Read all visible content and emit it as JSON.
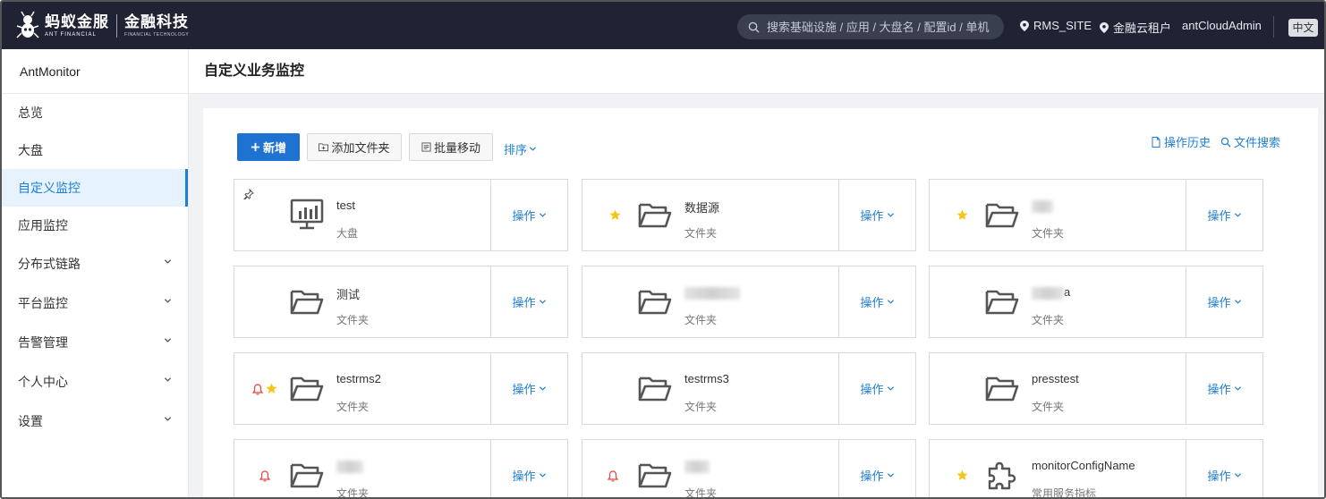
{
  "header": {
    "logo_brand": "蚂蚁金服",
    "logo_brand_en": "ANT FINANCIAL",
    "logo_sub": "金融科技",
    "logo_sub_en": "FINANCIAL TECHNOLOGY",
    "search_placeholder": "搜索基础设施 / 应用 / 大盘名 / 配置id / 单机",
    "site": "RMS_SITE",
    "tenant": "金融云租户",
    "user": "antCloudAdmin",
    "lang": "中文"
  },
  "sidebar": {
    "app_name": "AntMonitor",
    "items": [
      {
        "label": "总览"
      },
      {
        "label": "大盘"
      },
      {
        "label": "自定义监控"
      },
      {
        "label": "应用监控"
      },
      {
        "label": "分布式链路"
      },
      {
        "label": "平台监控"
      },
      {
        "label": "告警管理"
      },
      {
        "label": "个人中心"
      },
      {
        "label": "设置"
      }
    ]
  },
  "page": {
    "title": "自定义业务监控",
    "new_btn": "新增",
    "add_folder_btn": "添加文件夹",
    "batch_move_btn": "批量移动",
    "sort_label": "排序",
    "history_link": "操作历史",
    "file_search_link": "文件搜索",
    "op_label": "操作"
  },
  "cards": [
    {
      "name": "test",
      "type": "大盘",
      "icon": "dashboard-icon",
      "pinned": true
    },
    {
      "name": "数据源",
      "type": "文件夹",
      "icon": "folder-icon",
      "starred": true
    },
    {
      "name": "",
      "type": "文件夹",
      "icon": "folder-icon",
      "starred": true,
      "blurred": true
    },
    {
      "name": "测试",
      "type": "文件夹",
      "icon": "folder-icon"
    },
    {
      "name": "",
      "type": "文件夹",
      "icon": "folder-icon",
      "blurred": true
    },
    {
      "name": "a",
      "type": "文件夹",
      "icon": "folder-icon",
      "blurred": true
    },
    {
      "name": "testrms2",
      "type": "文件夹",
      "icon": "folder-icon",
      "alert": true,
      "starred": true
    },
    {
      "name": "testrms3",
      "type": "文件夹",
      "icon": "folder-icon"
    },
    {
      "name": "presstest",
      "type": "文件夹",
      "icon": "folder-icon"
    },
    {
      "name": "",
      "type": "文件夹",
      "icon": "folder-icon",
      "alert": true,
      "blurred": true
    },
    {
      "name": "",
      "type": "文件夹",
      "icon": "folder-icon",
      "alert": true,
      "blurred": true
    },
    {
      "name": "monitorConfigName",
      "type": "常用服务指标",
      "icon": "puzzle-icon",
      "starred": true
    }
  ],
  "colors": {
    "topbar": "#1f2333",
    "primary": "#1e72d2",
    "link": "#1e7ed6",
    "star": "#f5c518",
    "alert": "#e8423f"
  }
}
